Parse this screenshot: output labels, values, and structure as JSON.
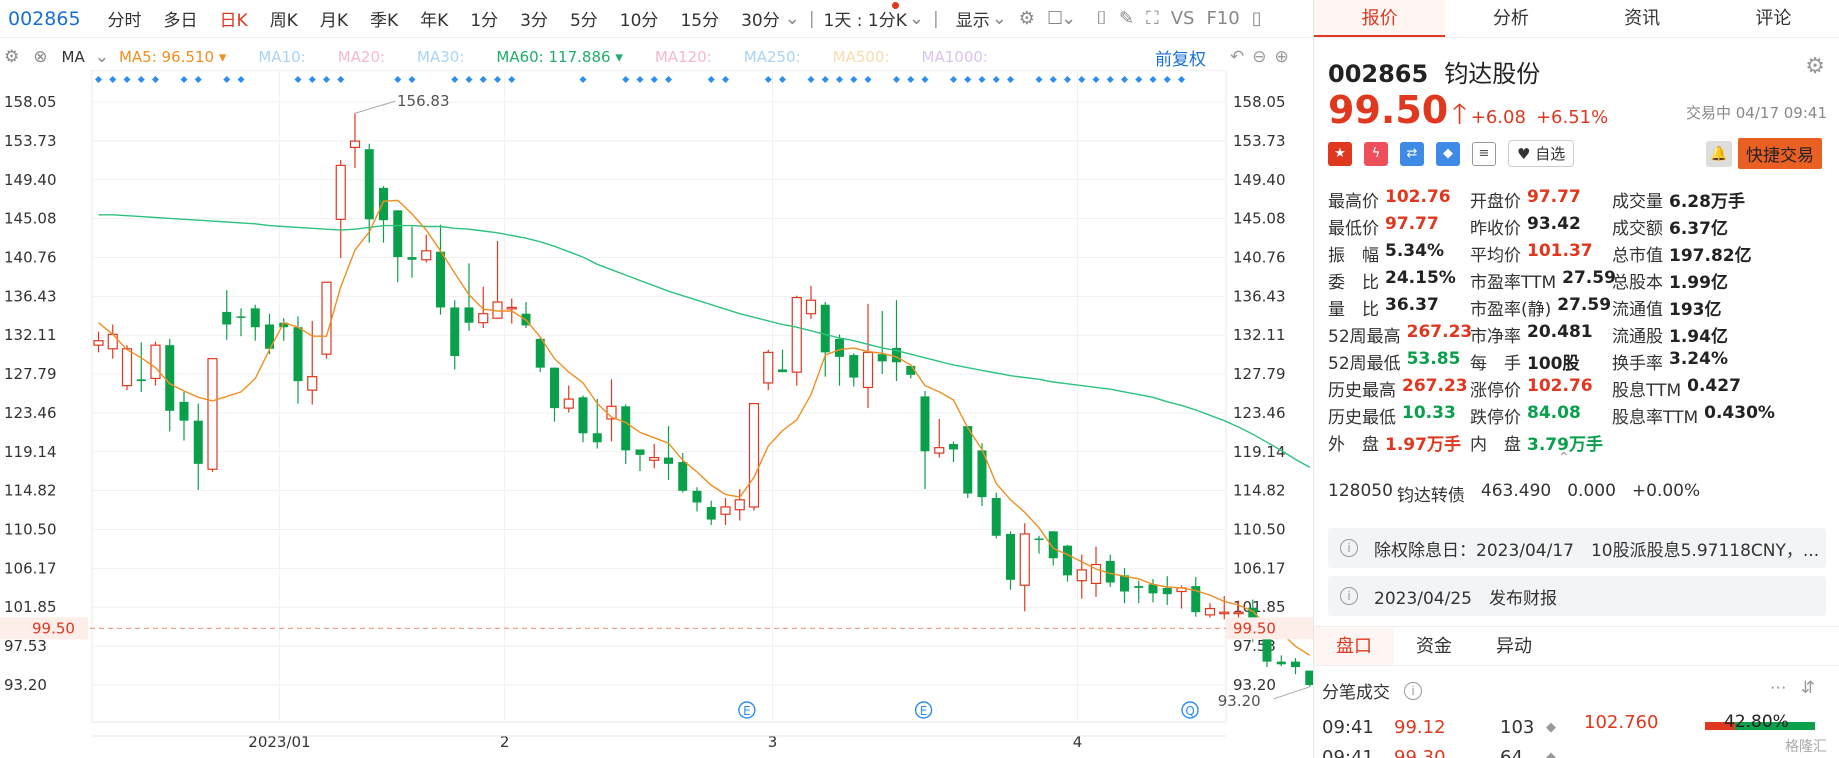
{
  "toolbar": {
    "code": "002865",
    "periods": [
      "分时",
      "多日",
      "日K",
      "周K",
      "月K",
      "季K",
      "年K",
      "1分",
      "3分",
      "5分",
      "10分",
      "15分",
      "30分"
    ],
    "active_period": "日K",
    "interval": "1天 : 1分K",
    "display": "显示",
    "vs": "VS",
    "f10": "F10"
  },
  "ma_bar": {
    "label": "MA",
    "ma5": "MA5:",
    "ma5_val": "96.510",
    "ma10": "MA10:",
    "ma20": "MA20:",
    "ma30": "MA30:",
    "ma60": "MA60:",
    "ma60_val": "117.886",
    "ma120": "MA120:",
    "ma250": "MA250:",
    "ma500": "MA500:",
    "ma1000": "MA1000:",
    "adjust": "前复权"
  },
  "colors": {
    "up": "#e0371f",
    "down": "#0aa04b",
    "ma5": "#f08f21",
    "ma60": "#2ec27e",
    "accent": "#1a6fd6"
  },
  "chart_data": {
    "type": "candlestick",
    "y_ticks": [
      "158.05",
      "153.73",
      "149.40",
      "145.08",
      "140.76",
      "136.43",
      "132.11",
      "127.79",
      "123.46",
      "119.14",
      "114.82",
      "110.50",
      "106.17",
      "101.85",
      "97.53",
      "93.20"
    ],
    "x_labels": [
      {
        "label": "2023/01",
        "idx": 12.7
      },
      {
        "label": "2",
        "idx": 28.5
      },
      {
        "label": "3",
        "idx": 47.3
      },
      {
        "label": "4",
        "idx": 68.7
      }
    ],
    "ylim": [
      93.2,
      158.05
    ],
    "current_price": "99.50",
    "high_label": "156.83",
    "low_label": "93.20",
    "candles": [
      [
        131.0,
        131.5,
        130.2,
        132.5
      ],
      [
        130.6,
        132.2,
        129.5,
        133.3
      ],
      [
        126.5,
        130.6,
        126.0,
        131.0
      ],
      [
        127.2,
        127.0,
        125.8,
        131.3
      ],
      [
        127.3,
        131.0,
        126.5,
        131.4
      ],
      [
        131.0,
        123.7,
        121.4,
        131.7
      ],
      [
        124.7,
        122.6,
        120.4,
        125.8
      ],
      [
        122.6,
        117.8,
        114.9,
        124.5
      ],
      [
        117.2,
        129.5,
        116.9,
        129.5
      ],
      [
        134.7,
        133.3,
        131.6,
        137.1
      ],
      [
        134.2,
        134.1,
        132.0,
        135.1
      ],
      [
        135.1,
        133.0,
        131.5,
        135.5
      ],
      [
        133.3,
        130.6,
        130.0,
        134.5
      ],
      [
        133.5,
        133.0,
        131.5,
        134.0
      ],
      [
        133.0,
        127.0,
        124.5,
        134.2
      ],
      [
        126.0,
        127.5,
        124.4,
        133.7
      ],
      [
        130.0,
        138.0,
        129.5,
        138.0
      ],
      [
        145.0,
        151.0,
        140.7,
        151.6
      ],
      [
        153.0,
        153.7,
        150.7,
        156.8
      ],
      [
        152.8,
        145.0,
        142.4,
        153.4
      ],
      [
        148.5,
        144.9,
        142.4,
        148.7
      ],
      [
        146.0,
        140.8,
        138.0,
        146.0
      ],
      [
        140.8,
        140.5,
        138.5,
        144.2
      ],
      [
        140.5,
        141.5,
        140.2,
        143.3
      ],
      [
        141.4,
        135.2,
        134.4,
        144.4
      ],
      [
        135.2,
        129.8,
        128.3,
        136.0
      ],
      [
        135.2,
        133.5,
        132.6,
        140.1
      ],
      [
        133.5,
        134.5,
        132.9,
        137.5
      ],
      [
        134.0,
        135.8,
        135.8,
        142.6
      ],
      [
        135.2,
        135.2,
        133.4,
        136.2
      ],
      [
        134.5,
        133.2,
        132.9,
        135.8
      ],
      [
        131.7,
        128.5,
        128.0,
        131.8
      ],
      [
        128.5,
        124.0,
        122.5,
        128.5
      ],
      [
        124.0,
        125.0,
        123.5,
        126.5
      ],
      [
        125.2,
        121.2,
        120.2,
        125.4
      ],
      [
        121.2,
        120.2,
        119.5,
        125.0
      ],
      [
        122.8,
        124.2,
        120.3,
        127.2
      ],
      [
        124.2,
        119.3,
        117.8,
        124.4
      ],
      [
        119.4,
        118.8,
        117.0,
        119.4
      ],
      [
        118.2,
        118.5,
        117.3,
        120.0
      ],
      [
        118.5,
        117.8,
        116.0,
        122.0
      ],
      [
        118.0,
        114.8,
        114.6,
        119.0
      ],
      [
        114.8,
        113.5,
        112.5,
        115.2
      ],
      [
        113.0,
        111.6,
        111.0,
        113.7
      ],
      [
        112.2,
        113.0,
        111.0,
        114.0
      ],
      [
        112.7,
        113.8,
        111.5,
        115.0
      ],
      [
        113.0,
        124.5,
        112.6,
        124.5
      ],
      [
        126.8,
        130.2,
        126.0,
        130.5
      ],
      [
        128.3,
        128.0,
        128.0,
        130.5
      ],
      [
        128.0,
        136.3,
        126.5,
        136.5
      ],
      [
        134.5,
        136.0,
        133.9,
        137.6
      ],
      [
        135.5,
        130.2,
        127.5,
        135.8
      ],
      [
        131.7,
        129.7,
        126.5,
        132.2
      ],
      [
        129.9,
        127.4,
        126.4,
        130.1
      ],
      [
        126.3,
        130.2,
        124.0,
        135.6
      ],
      [
        130.0,
        129.2,
        127.8,
        134.8
      ],
      [
        130.7,
        129.1,
        127.0,
        136.0
      ],
      [
        128.7,
        127.7,
        127.3,
        128.7
      ],
      [
        125.3,
        119.2,
        115.0,
        125.9
      ],
      [
        119.0,
        119.6,
        118.5,
        122.8
      ],
      [
        120.0,
        119.4,
        118.0,
        120.3
      ],
      [
        122.0,
        114.5,
        114.0,
        122.0
      ],
      [
        119.3,
        114.1,
        113.1,
        120.1
      ],
      [
        114.0,
        109.8,
        109.5,
        114.6
      ],
      [
        110.0,
        104.9,
        103.8,
        110.3
      ],
      [
        104.3,
        110.0,
        101.4,
        111.2
      ],
      [
        109.5,
        109.4,
        107.8,
        109.8
      ],
      [
        110.3,
        107.3,
        106.5,
        110.3
      ],
      [
        108.7,
        105.4,
        104.7,
        108.8
      ],
      [
        104.8,
        106.0,
        102.8,
        107.7
      ],
      [
        104.5,
        106.6,
        103.0,
        108.6
      ],
      [
        107.0,
        104.6,
        104.1,
        107.7
      ],
      [
        105.4,
        103.6,
        102.3,
        106.2
      ],
      [
        104.2,
        104.0,
        102.3,
        104.8
      ],
      [
        104.4,
        103.4,
        102.4,
        105.0
      ],
      [
        104.0,
        103.3,
        102.1,
        105.3
      ],
      [
        103.6,
        104.0,
        101.7,
        104.3
      ],
      [
        104.2,
        101.3,
        100.8,
        105.2
      ],
      [
        101.0,
        101.7,
        100.7,
        102.3
      ],
      [
        101.3,
        101.3,
        100.5,
        103.1
      ],
      [
        101.2,
        101.3,
        99.7,
        102.6
      ],
      [
        101.8,
        98.8,
        98.0,
        102.7
      ],
      [
        98.3,
        95.8,
        95.2,
        98.9
      ],
      [
        95.8,
        95.5,
        95.3,
        96.5
      ],
      [
        95.8,
        95.2,
        94.4,
        96.2
      ],
      [
        94.8,
        93.2,
        93.0,
        94.8
      ],
      [
        97.7,
        99.5,
        97.7,
        102.76
      ]
    ],
    "ma5": [
      133.5,
      132.2,
      130.5,
      129.6,
      128.5,
      126.7,
      125.9,
      125.2,
      124.8,
      125.3,
      125.8,
      127.3,
      130.5,
      133.5,
      133.0,
      132.0,
      132.0,
      137.5,
      141.6,
      143.6,
      147.0,
      147.1,
      145.6,
      143.8,
      141.5,
      139.0,
      136.6,
      135.0,
      134.8,
      134.8,
      133.8,
      131.9,
      129.5,
      128.0,
      126.8,
      124.5,
      123.0,
      122.4,
      121.3,
      120.7,
      120.1,
      118.2,
      116.9,
      115.4,
      114.4,
      114.1,
      116.3,
      119.8,
      121.5,
      122.7,
      125.5,
      129.9,
      130.5,
      130.7,
      130.3,
      130.1,
      129.7,
      128.8,
      126.5,
      125.8,
      124.9,
      121.8,
      119.4,
      115.6,
      113.8,
      112.4,
      110.7,
      108.4,
      107.7,
      106.9,
      106.1,
      105.6,
      105.3,
      105.0,
      104.4,
      104.1,
      104.0,
      103.7,
      103.2,
      102.5,
      102.1,
      101.4,
      99.8,
      99.0,
      97.5,
      96.5
    ],
    "ma60": [
      145.5,
      145.5,
      145.4,
      145.3,
      145.2,
      145.1,
      145.0,
      144.9,
      144.8,
      144.7,
      144.6,
      144.5,
      144.3,
      144.2,
      144.1,
      144.0,
      143.9,
      143.8,
      143.9,
      144.1,
      144.3,
      144.3,
      144.3,
      144.2,
      144.2,
      144.0,
      143.9,
      143.7,
      143.5,
      143.2,
      142.9,
      142.5,
      142.0,
      141.4,
      140.8,
      140.0,
      139.4,
      138.8,
      138.2,
      137.6,
      137.0,
      136.5,
      136.0,
      135.5,
      135.0,
      134.5,
      134.1,
      133.7,
      133.3,
      133.0,
      132.6,
      132.2,
      131.8,
      131.5,
      131.1,
      130.7,
      130.4,
      130.0,
      129.6,
      129.2,
      128.8,
      128.5,
      128.2,
      127.9,
      127.6,
      127.4,
      127.2,
      126.9,
      126.7,
      126.5,
      126.3,
      126.1,
      125.8,
      125.5,
      125.2,
      124.7,
      124.3,
      123.8,
      123.2,
      122.6,
      121.9,
      121.1,
      120.2,
      119.3,
      118.3,
      117.4
    ],
    "events": [
      {
        "idx": 45.5,
        "label": "E"
      },
      {
        "idx": 57.9,
        "label": "E"
      },
      {
        "idx": 76.6,
        "label": "Q"
      }
    ]
  },
  "tabs": [
    "报价",
    "分析",
    "资讯",
    "评论"
  ],
  "active_tab": "报价",
  "stock": {
    "code": "002865",
    "name": "钧达股份",
    "price": "99.50",
    "change": "+6.08",
    "change_pct": "+6.51%",
    "status": "交易中 04/17 09:41",
    "watch": "自选",
    "quick_trade": "快捷交易"
  },
  "stats": [
    [
      {
        "k": "最高价",
        "v": "102.76",
        "c": "red"
      },
      {
        "k": "开盘价",
        "v": "97.77",
        "c": "red"
      },
      {
        "k": "成交量",
        "v": "6.28万手",
        "c": "blk"
      }
    ],
    [
      {
        "k": "最低价",
        "v": "97.77",
        "c": "red"
      },
      {
        "k": "昨收价",
        "v": "93.42",
        "c": "blk"
      },
      {
        "k": "成交额",
        "v": "6.37亿",
        "c": "blk"
      }
    ],
    [
      {
        "k": "振　幅",
        "v": "5.34%",
        "c": "blk"
      },
      {
        "k": "平均价",
        "v": "101.37",
        "c": "red"
      },
      {
        "k": "总市值",
        "v": "197.82亿",
        "c": "blk"
      }
    ],
    [
      {
        "k": "委　比",
        "v": "24.15%",
        "c": "blk"
      },
      {
        "k": "市盈率TTM",
        "v": "27.59",
        "c": "blk"
      },
      {
        "k": "总股本",
        "v": "1.99亿",
        "c": "blk"
      }
    ],
    [
      {
        "k": "量　比",
        "v": "36.37",
        "c": "blk"
      },
      {
        "k": "市盈率(静)",
        "v": "27.59",
        "c": "blk"
      },
      {
        "k": "流通值",
        "v": "193亿",
        "c": "blk"
      }
    ],
    [
      {
        "k": "52周最高",
        "v": "267.23",
        "c": "red"
      },
      {
        "k": "市净率",
        "v": "20.481",
        "c": "blk"
      },
      {
        "k": "流通股",
        "v": "1.94亿",
        "c": "blk"
      }
    ],
    [
      {
        "k": "52周最低",
        "v": "53.85",
        "c": "green"
      },
      {
        "k": "每　手",
        "v": "100股",
        "c": "blk"
      },
      {
        "k": "换手率",
        "v": "3.24%",
        "c": "blk"
      }
    ],
    [
      {
        "k": "历史最高",
        "v": "267.23",
        "c": "red"
      },
      {
        "k": "涨停价",
        "v": "102.76",
        "c": "red"
      },
      {
        "k": "股息TTM",
        "v": "0.427",
        "c": "blk"
      }
    ],
    [
      {
        "k": "历史最低",
        "v": "10.33",
        "c": "green"
      },
      {
        "k": "跌停价",
        "v": "84.08",
        "c": "green"
      },
      {
        "k": "股息率TTM",
        "v": "0.430%",
        "c": "blk"
      }
    ],
    [
      {
        "k": "外　盘",
        "v": "1.97万手",
        "c": "red"
      },
      {
        "k": "内　盘",
        "v": "3.79万手",
        "c": "green"
      }
    ]
  ],
  "bond": {
    "code": "128050",
    "name": "钧达转债",
    "price": "463.490",
    "chg": "0.000",
    "pct": "+0.00%"
  },
  "notices": [
    {
      "text": "除权除息日：2023/04/17　10股派股息5.97118CNY，..."
    },
    {
      "text": "2023/04/25　发布财报"
    }
  ],
  "bottom_tabs": [
    "盘口",
    "资金",
    "异动"
  ],
  "ticks_title": "分笔成交",
  "ticks": [
    {
      "t": "09:41",
      "p": "99.12",
      "v": "103",
      "d": "◆"
    },
    {
      "t": "09:41",
      "p": "99.30",
      "v": "64",
      "d": "◆"
    }
  ],
  "book": {
    "price": "102.760",
    "pct": "42.80%"
  },
  "watermark": "格隆汇"
}
